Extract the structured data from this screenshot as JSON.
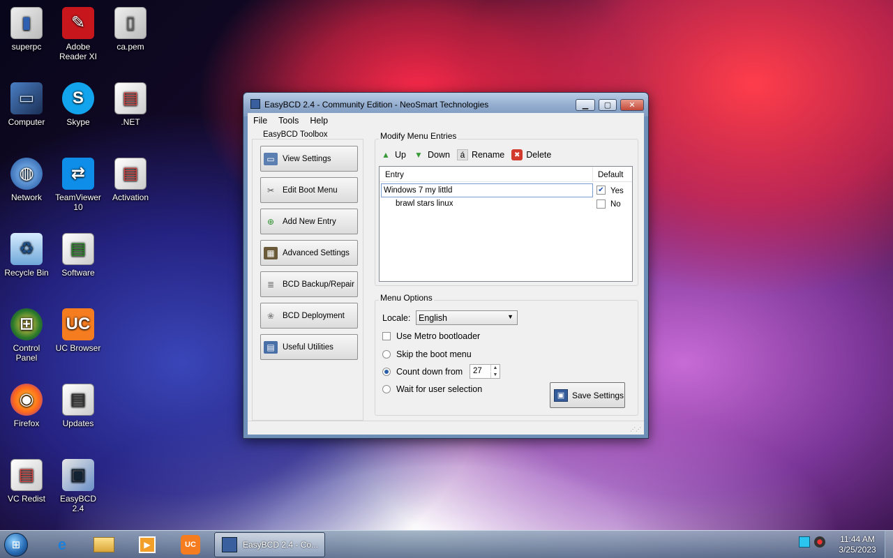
{
  "desktop": {
    "icons": [
      {
        "label": "superpc",
        "icon": "user-folder-icon"
      },
      {
        "label": "Adobe Reader XI",
        "icon": "adobe-reader-icon"
      },
      {
        "label": "ca.pem",
        "icon": "file-icon"
      },
      {
        "label": "Computer",
        "icon": "computer-icon"
      },
      {
        "label": "Skype",
        "icon": "skype-icon"
      },
      {
        "label": ".NET",
        "icon": "folder-icon"
      },
      {
        "label": "Network",
        "icon": "network-icon"
      },
      {
        "label": "TeamViewer 10",
        "icon": "teamviewer-icon"
      },
      {
        "label": "Activation",
        "icon": "folder-icon"
      },
      {
        "label": "Recycle Bin",
        "icon": "recycle-bin-icon"
      },
      {
        "label": "Software",
        "icon": "folder-icon"
      },
      {
        "label": "Control Panel",
        "icon": "control-panel-icon"
      },
      {
        "label": "UC Browser",
        "icon": "uc-browser-icon"
      },
      {
        "label": "Firefox",
        "icon": "firefox-icon"
      },
      {
        "label": "Updates",
        "icon": "folder-icon"
      },
      {
        "label": "VC Redist",
        "icon": "folder-icon"
      },
      {
        "label": "EasyBCD 2.4",
        "icon": "easybcd-icon"
      }
    ]
  },
  "window": {
    "title": "EasyBCD 2.4 - Community Edition - NeoSmart Technologies",
    "menu": [
      "File",
      "Tools",
      "Help"
    ],
    "toolbox": {
      "label": "EasyBCD Toolbox",
      "buttons": [
        {
          "label": "View Settings",
          "icon": "monitor-icon"
        },
        {
          "label": "Edit Boot Menu",
          "icon": "wrench-icon"
        },
        {
          "label": "Add New Entry",
          "icon": "add-entry-icon"
        },
        {
          "label": "Advanced Settings",
          "icon": "chip-icon"
        },
        {
          "label": "BCD Backup/Repair",
          "icon": "database-icon"
        },
        {
          "label": "BCD Deployment",
          "icon": "deployment-icon"
        },
        {
          "label": "Useful Utilities",
          "icon": "utilities-icon"
        }
      ]
    },
    "modify": {
      "title": "Modify Menu Entries",
      "actions": [
        {
          "label": "Up",
          "icon": "arrow-up-icon"
        },
        {
          "label": "Down",
          "icon": "arrow-down-icon"
        },
        {
          "label": "Rename",
          "icon": "rename-icon",
          "glyph": "á"
        },
        {
          "label": "Delete",
          "icon": "delete-icon"
        }
      ],
      "columns": {
        "entry": "Entry",
        "default": "Default"
      },
      "rows": [
        {
          "entry": "Windows 7 my littld",
          "default_label": "Yes",
          "default_checked": true,
          "editing": true
        },
        {
          "entry": "brawl stars linux",
          "default_label": "No",
          "default_checked": false,
          "editing": false
        }
      ]
    },
    "options": {
      "title": "Menu Options",
      "locale_label": "Locale:",
      "locale_value": "English",
      "metro_label": "Use Metro bootloader",
      "skip_label": "Skip the boot menu",
      "countdown_label": "Count down from",
      "countdown_value": "27",
      "wait_label": "Wait for user selection",
      "selected_option": "countdown",
      "save_label": "Save Settings"
    }
  },
  "taskbar": {
    "task_label": "EasyBCD 2.4 - Co...",
    "time": "11:44 AM",
    "date": "3/25/2023"
  },
  "colors": {
    "accent": "#2a5ea8",
    "close_button": "#c4493a"
  }
}
